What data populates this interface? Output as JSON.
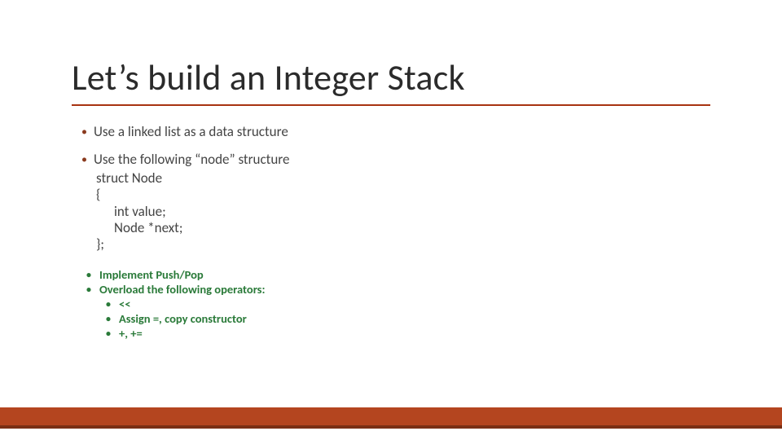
{
  "title": "Let’s build an Integer Stack",
  "bullets": {
    "b1": "Use a linked list as a data structure",
    "b2": "Use the following “node” structure",
    "code": {
      "l1": "struct Node",
      "l2": "{",
      "l3": "int value;",
      "l4": "Node *next;",
      "l5": "};"
    },
    "g1": "Implement Push/Pop",
    "g2": "Overload the following operators:",
    "g2a": "<<",
    "g2b": "Assign =, copy constructor",
    "g2c": "+, +="
  },
  "glyphs": {
    "bullet": "•"
  }
}
